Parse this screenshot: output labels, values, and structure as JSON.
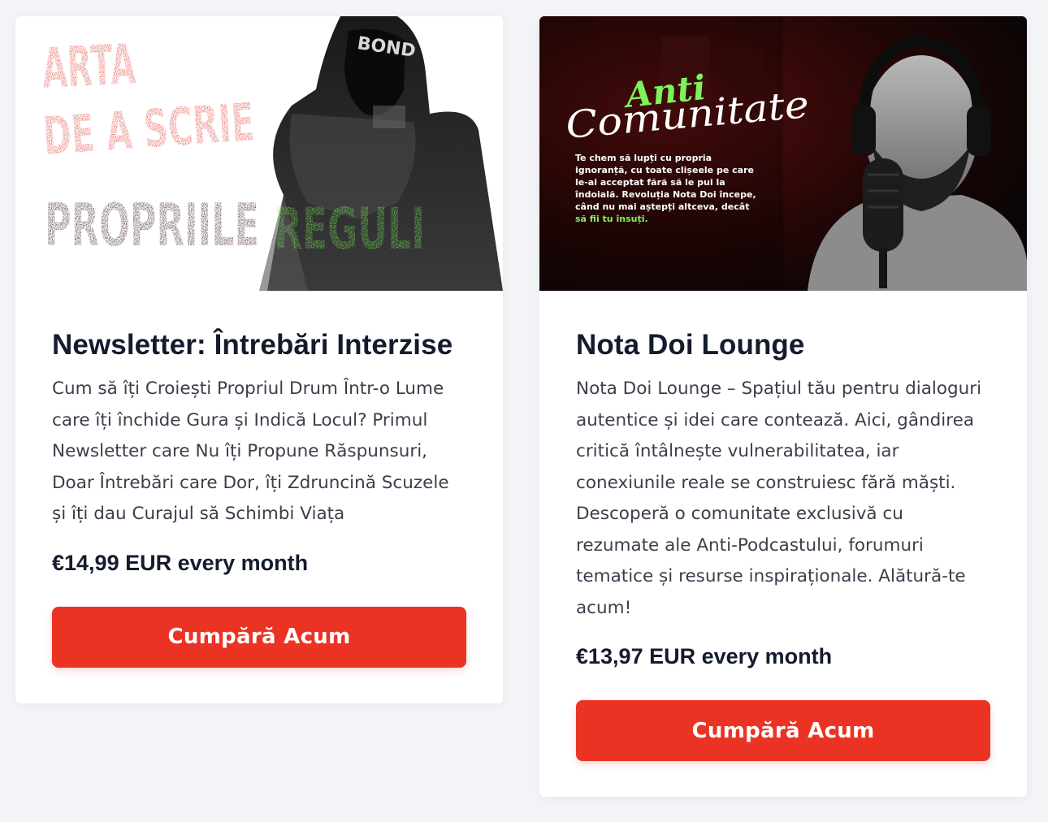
{
  "products": [
    {
      "banner": {
        "line1": "ARTA",
        "line2": "DE A SCRIE",
        "line3a": "PROPRIILE",
        "line3b": "REGULI",
        "hood_text": "BOND"
      },
      "title": "Newsletter: Întrebări Interzise",
      "description": "Cum să îți Croiești Propriul Drum Într-o Lume care îți închide Gura și Indică Locul? Primul Newsletter care Nu îți Propune Răspunsuri, Doar Întrebări care Dor, îți Zdruncină Scuzele și îți dau Curajul să Schimbi Viața",
      "price": "€14,99 EUR every month",
      "button": "Cumpără Acum"
    },
    {
      "banner": {
        "script1": "Anti",
        "script2": "Comunitate",
        "blurb1": "Te chem să lupți cu propria",
        "blurb2": "ignoranță, cu toate clișeele pe care",
        "blurb3": "le-ai acceptat fără să le pui la",
        "blurb4": "îndoială. Revoluția Nota Doi începe,",
        "blurb5": "când nu mai aștepți altceva, decât",
        "blurb6": "să fii tu însuți."
      },
      "title": "Nota Doi Lounge",
      "description": "Nota Doi Lounge – Spațiul tău pentru dialoguri autentice și idei care contează. Aici, gândirea critică întâlnește vulnerabilitatea, iar conexiunile reale se construiesc fără măști. Descoperă o comunitate exclusivă cu rezumate ale Anti-Podcastului, forumuri tematice și resurse inspiraționale. Alătură-te acum!",
      "price": "€13,97 EUR every month",
      "button": "Cumpără Acum"
    }
  ],
  "colors": {
    "accent": "#eb3324",
    "title": "#141b2d",
    "text": "#3a3f4b",
    "background": "#f3f4f8",
    "banner_red": "#e2352b",
    "banner_green": "#7df25a"
  }
}
